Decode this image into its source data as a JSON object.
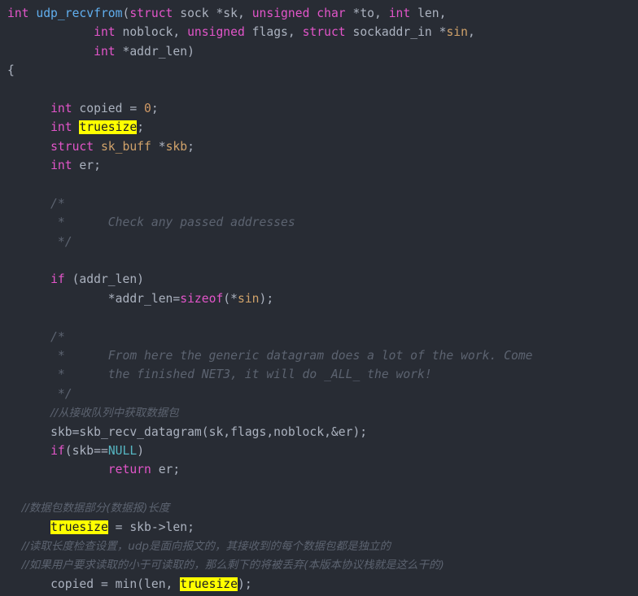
{
  "editor": {
    "background_color": "#282c34",
    "default_text_color": "#abb2bf",
    "highlight_color": "#ffff00",
    "highlighted_term": "truesize",
    "language": "C",
    "colors": {
      "keyword": "#e255c9",
      "function": "#61afef",
      "variable": "#d0a26a",
      "number": "#d19a66",
      "constant": "#56b6c2",
      "comment": "#5c6370"
    }
  },
  "code": {
    "l1_kw_int": "int",
    "l1_fn": "udp_recvfrom",
    "l1_p1": "(",
    "l1_kw_struct": "struct",
    "l1_sock": " sock *sk, ",
    "l1_kw_unsigned": "unsigned",
    "l1_sp1": " ",
    "l1_kw_char": "char",
    "l1_to": " *to, ",
    "l1_kw_int2": "int",
    "l1_len": " len,",
    "l2_indent": "            ",
    "l2_kw_int": "int",
    "l2_noblock": " noblock, ",
    "l2_kw_unsigned": "unsigned",
    "l2_flags": " flags, ",
    "l2_kw_struct": "struct",
    "l2_sockaddr": " sockaddr_in *",
    "l2_sin": "sin",
    "l2_comma": ",",
    "l3_indent": "            ",
    "l3_kw_int": "int",
    "l3_addrlen": " *addr_len)",
    "l4_brace": "{",
    "l6_indent": "      ",
    "l6_kw_int": "int",
    "l6_copied": " copied = ",
    "l6_num": "0",
    "l6_semi": ";",
    "l7_indent": "      ",
    "l7_kw_int": "int",
    "l7_sp": " ",
    "l7_hl": "truesize",
    "l7_semi": ";",
    "l8_indent": "      ",
    "l8_kw_struct": "struct",
    "l8_sp": " ",
    "l8_skbuff": "sk_buff",
    "l8_star": " *",
    "l8_skb": "skb",
    "l8_semi": ";",
    "l9_indent": "      ",
    "l9_kw_int": "int",
    "l9_er": " er;",
    "l11_c1": "      /*",
    "l12_c2": "       *      Check any passed addresses",
    "l13_c3": "       */",
    "l15_indent": "      ",
    "l15_kw_if": "if",
    "l15_cond": " (addr_len)",
    "l16_indent": "              ",
    "l16_addrlen": "*addr_len=",
    "l16_kw_sizeof": "sizeof",
    "l16_paren": "(*",
    "l16_sin": "sin",
    "l16_end": ");",
    "l18_c1": "      /*",
    "l19_c2": "       *      From here the generic datagram does a lot of the work. Come",
    "l20_c3": "       *      the finished NET3, it will do _ALL_ the work!",
    "l21_c4": "       */",
    "l22_cjk": "//从接收队列中获取数据包",
    "l23_indent": "      ",
    "l23_skb_call": "skb=skb_recv_datagram(sk,flags,noblock,&er);",
    "l24_indent": "      ",
    "l24_kw_if": "if",
    "l24_cond1": "(skb==",
    "l24_null": "NULL",
    "l24_cond2": ")",
    "l25_indent": "              ",
    "l25_kw_return": "return",
    "l25_er": " er;",
    "l27_cjk": "//数据包数据部分(数据报)长度",
    "l28_indent": "      ",
    "l28_hl": "truesize",
    "l28_rest": " = skb->len;",
    "l29_cjk": "//读取长度检查设置，udp是面向报文的，其接收到的每个数据包都是独立的",
    "l30_cjk": "//如果用户要求读取的小于可读取的，那么剩下的将被丢弃(本版本协议栈就是这么干的)",
    "l31_indent": "      ",
    "l31_copied": "copied = min(len, ",
    "l31_hl": "truesize",
    "l31_end": ");"
  }
}
